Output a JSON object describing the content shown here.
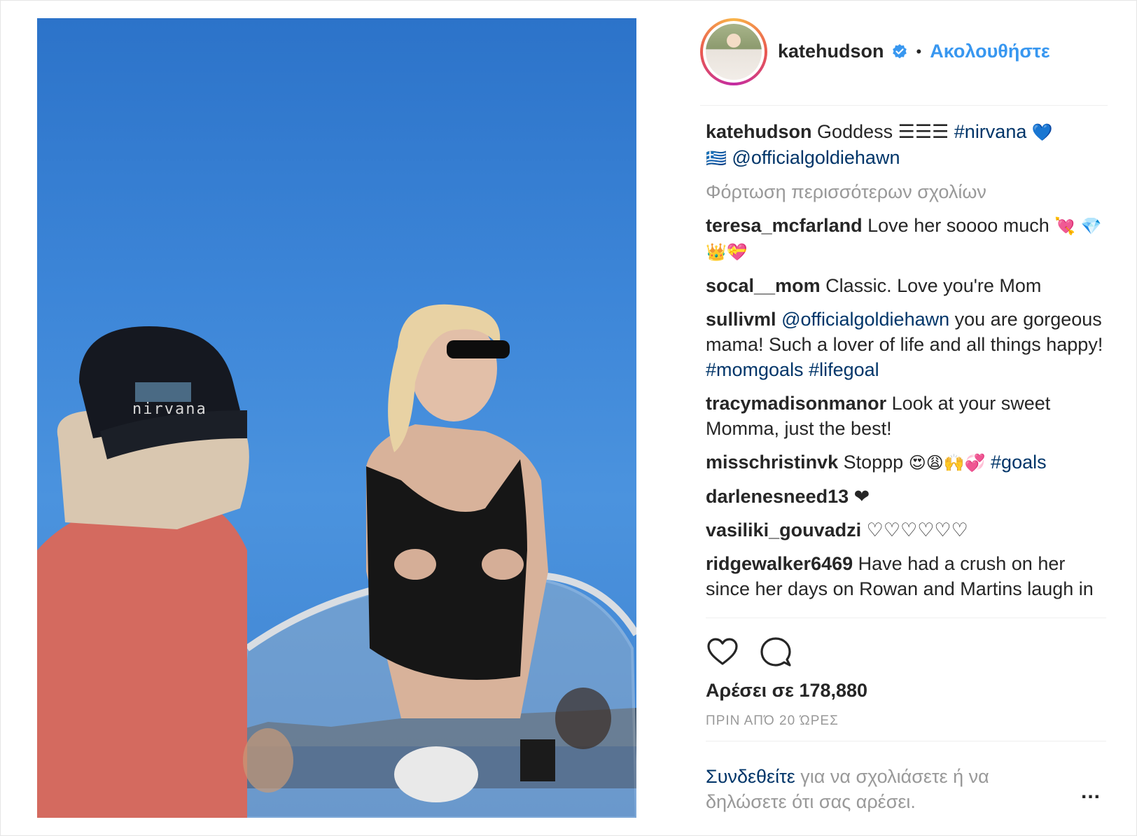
{
  "post": {
    "username": "katehudson",
    "follow_label": "Ακολουθήστε",
    "separator": "•"
  },
  "photo": {
    "alt": "",
    "cap_text": "nirvana"
  },
  "caption": {
    "user": "katehudson",
    "text": "Goddess",
    "flag_emoji": "☰☰☰",
    "hashtag": "#nirvana",
    "heart": "💙",
    "greek_flag": "🇬🇷",
    "mention": "@officialgoldiehawn"
  },
  "load_more": "Φόρτωση περισσότερων σχολίων",
  "comments": [
    {
      "user": "teresa_mcfarland",
      "text": "Love her soooo much",
      "emoji": "💘 💎👑💝"
    },
    {
      "user": "socal__mom",
      "text": "Classic. Love you're Mom"
    },
    {
      "user": "sullivml",
      "mention": "@officialgoldiehawn",
      "text": "you are gorgeous mama! Such a lover of life and all things happy!",
      "tags": "#momgoals #lifegoal"
    },
    {
      "user": "tracymadisonmanor",
      "text": "Look at your sweet Momma, just the best!"
    },
    {
      "user": "misschristinvk",
      "text": "Stoppp",
      "emoji": "😍😩🙌💞",
      "tags": "#goals"
    },
    {
      "user": "darlenesneed13",
      "text": "❤"
    },
    {
      "user": "vasiliki_gouvadzi",
      "text": "♡♡♡♡♡♡"
    },
    {
      "user": "ridgewalker6469",
      "text": "Have had a crush on her since her days on Rowan and Martins laugh in ......"
    }
  ],
  "actions": {
    "like_icon": "heart-icon",
    "comment_icon": "comment-icon",
    "likes": "Αρέσει σε 178,880",
    "time": "ΠΡΙΝ ΑΠΌ 20 ΏΡΕΣ"
  },
  "login": {
    "link": "Συνδεθείτε",
    "rest": "για να σχολιάσετε ή να δηλώσετε ότι σας αρέσει.",
    "more": "..."
  },
  "colors": {
    "accent": "#3897f0",
    "link": "#003569",
    "muted": "#999999"
  }
}
